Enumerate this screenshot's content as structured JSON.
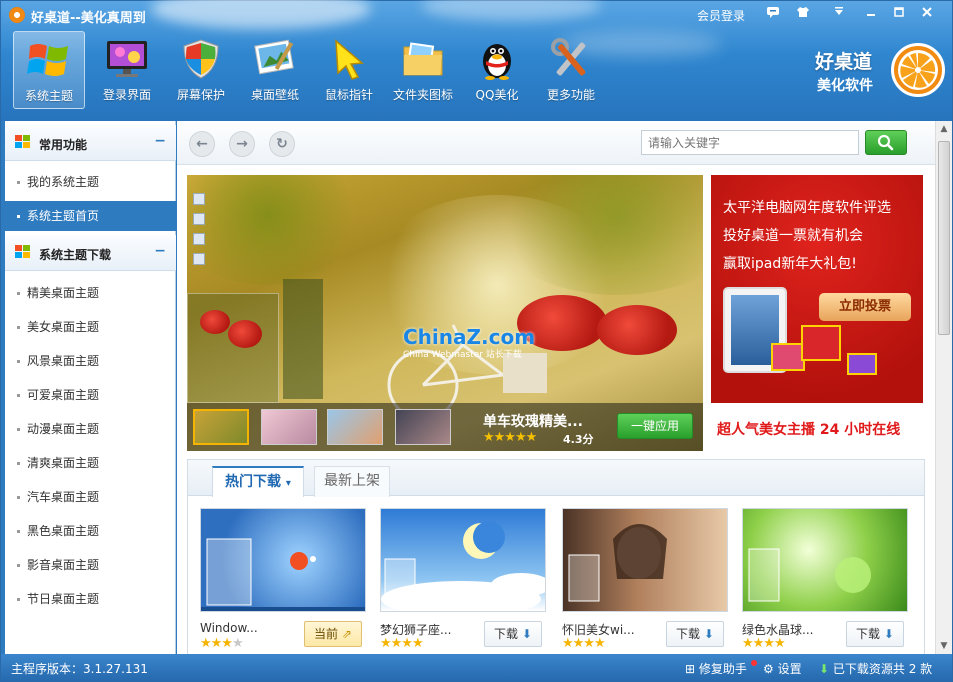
{
  "window": {
    "title": "好桌道--美化真周到",
    "login": "会员登录",
    "buttons": [
      "message-icon",
      "skin-icon",
      "menu-icon",
      "minimize-icon",
      "maximize-icon",
      "close-icon"
    ]
  },
  "nav": [
    {
      "label": "系统主题",
      "icon": "windows-logo-icon",
      "active": true
    },
    {
      "label": "登录界面",
      "icon": "monitor-icon",
      "active": false
    },
    {
      "label": "屏幕保护",
      "icon": "shield-icon",
      "active": false
    },
    {
      "label": "桌面壁纸",
      "icon": "wallpaper-icon",
      "active": false
    },
    {
      "label": "鼠标指针",
      "icon": "cursor-icon",
      "active": false
    },
    {
      "label": "文件夹图标",
      "icon": "folder-icon",
      "active": false
    },
    {
      "label": "QQ美化",
      "icon": "qq-penguin-icon",
      "active": false
    },
    {
      "label": "更多功能",
      "icon": "tools-icon",
      "active": false
    }
  ],
  "brand": {
    "line1": "好桌道",
    "line2": "美化软件"
  },
  "sidebar": {
    "section1": {
      "title": "常用功能",
      "min": "−"
    },
    "common": [
      {
        "label": "我的系统主题",
        "active": false
      },
      {
        "label": "系统主题首页",
        "active": true
      }
    ],
    "section2": {
      "title": "系统主题下载",
      "min": "−"
    },
    "downloads": [
      "精美桌面主题",
      "美女桌面主题",
      "风景桌面主题",
      "可爱桌面主题",
      "动漫桌面主题",
      "清爽桌面主题",
      "汽车桌面主题",
      "黑色桌面主题",
      "影音桌面主题",
      "节日桌面主题"
    ]
  },
  "toolbar": {
    "back": "←",
    "forward": "→",
    "refresh": "↻",
    "search_placeholder": "请输入关键字"
  },
  "banner": {
    "caption": "单车玫瑰精美...",
    "rating": "★★★★★",
    "score": "4.3分",
    "apply": "一键应用",
    "watermark": "ChinaZ.com",
    "watermark_sub": "China Webmaster 站长下载"
  },
  "ad": {
    "line1": "太平洋电脑网年度软件评选",
    "line2": "投好桌道一票就有机会",
    "line3": "赢取ipad新年大礼包!",
    "vote": "立即投票",
    "caption": "超人气美女主播 24 小时在线"
  },
  "downloads_panel": {
    "tab_hot": "热门下载",
    "tab_new": "最新上架",
    "cards": [
      {
        "name": "Window...",
        "stars_full": "★★★",
        "stars_empty": "★",
        "button": "当前",
        "current": true
      },
      {
        "name": "梦幻狮子座...",
        "stars_full": "★★★★",
        "stars_empty": "",
        "button": "下载",
        "current": false
      },
      {
        "name": "怀旧美女wi...",
        "stars_full": "★★★★",
        "stars_empty": "",
        "button": "下载",
        "current": false
      },
      {
        "name": "绿色水晶球...",
        "stars_full": "★★★★",
        "stars_empty": "",
        "button": "下载",
        "current": false
      }
    ]
  },
  "status": {
    "version": "主程序版本：3.1.27.131",
    "repair": "修复助手",
    "settings": "设置",
    "downloaded": "已下载资源共 2 款"
  },
  "colors": {
    "accent": "#2f7bbf",
    "brand_orange": "#f28b12",
    "green_button": "#2a9e2c",
    "ad_red": "#c8160f"
  }
}
